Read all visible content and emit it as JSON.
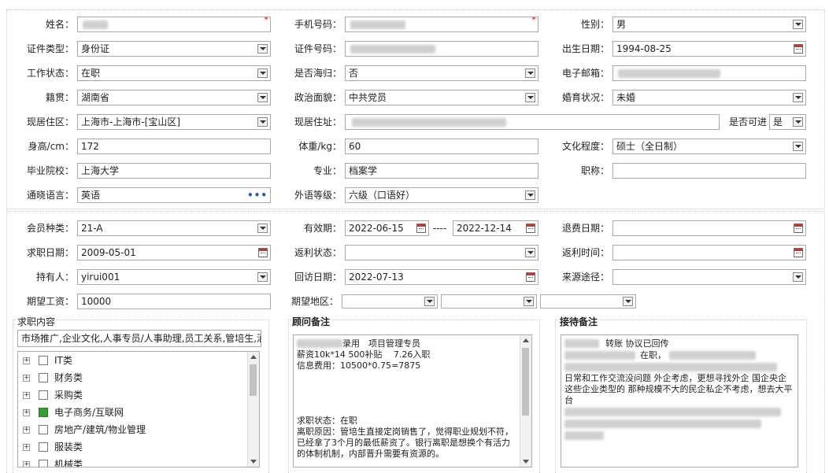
{
  "row1": {
    "name_label": "姓名：",
    "name_value": "",
    "phone_label": "手机号码：",
    "phone_value": "",
    "gender_label": "性别：",
    "gender_value": "男"
  },
  "row2": {
    "idtype_label": "证件类型：",
    "idtype_value": "身份证",
    "idno_label": "证件号码：",
    "idno_value": "",
    "birth_label": "出生日期：",
    "birth_value": "1994-08-25"
  },
  "row3": {
    "workstatus_label": "工作状态：",
    "workstatus_value": "在职",
    "returnee_label": "是否海归：",
    "returnee_value": "否",
    "email_label": "电子邮箱：",
    "email_value": ""
  },
  "row4": {
    "origin_label": "籍贯：",
    "origin_value": "湖南省",
    "politics_label": "政治面貌：",
    "politics_value": "中共党员",
    "marital_label": "婚育状况：",
    "marital_value": "未婚"
  },
  "row5": {
    "region_label": "现居住区：",
    "region_value": "上海市-上海市-[宝山区]",
    "address_label": "现居住址：",
    "address_value": "",
    "visit_label": "是否可进",
    "visit_value": "是"
  },
  "row6": {
    "height_label": "身高/cm：",
    "height_value": "172",
    "weight_label": "体重/kg：",
    "weight_value": "60",
    "edu_label": "文化程度：",
    "edu_value": "硕士（全日制）"
  },
  "row7": {
    "school_label": "毕业院校：",
    "school_value": "上海大学",
    "major_label": "专业：",
    "major_value": "档案学",
    "title_label": "职称：",
    "title_value": ""
  },
  "row8": {
    "lang_label": "通晓语言：",
    "lang_value": "英语",
    "lang_more": "•••",
    "langlevel_label": "外语等级：",
    "langlevel_value": "六级（口语好）"
  },
  "row9": {
    "member_label": "会员种类：",
    "member_value": "21-A",
    "valid_label": "有效期：",
    "valid_from": "2022-06-15",
    "valid_sep": "----",
    "valid_to": "2022-12-14",
    "refund_label": "退费日期：",
    "refund_value": ""
  },
  "row10": {
    "jobdate_label": "求职日期：",
    "jobdate_value": "2009-05-01",
    "rebate_label": "返利状态：",
    "rebate_value": "",
    "rebatetime_label": "返利时间：",
    "rebatetime_value": ""
  },
  "row11": {
    "holder_label": "持有人：",
    "holder_value": "yirui001",
    "revisit_label": "回访日期：",
    "revisit_value": "2022-07-13",
    "source_label": "来源途径：",
    "source_value": ""
  },
  "row12": {
    "salary_label": "期望工资：",
    "salary_value": "10000",
    "area_label": "期望地区：",
    "area1": "",
    "area2": "",
    "area3": ""
  },
  "job": {
    "title": "求职内容",
    "selected": "市场推广,企业文化,人事专员/人事助理,员工关系,管培生,酒",
    "tree": [
      {
        "label": "IT类",
        "checked": false
      },
      {
        "label": "财务类",
        "checked": false
      },
      {
        "label": "采购类",
        "checked": false
      },
      {
        "label": "电子商务/互联网",
        "checked": true
      },
      {
        "label": "房地产/建筑/物业管理",
        "checked": false
      },
      {
        "label": "服装类",
        "checked": false
      },
      {
        "label": "机械类",
        "checked": false
      }
    ],
    "expand_symbol": "+"
  },
  "consultant": {
    "title": "顾问备注",
    "line1": "录用　项目管理专员",
    "line2": "薪资10k*14 500补贴　 7.26入职",
    "line3": "信息费用：10500*0.75=7875",
    "line4": "求职状态：在职",
    "line5": "离职原因：管培生直接定岗销售了，觉得职业规划不符，已经拿了3个月的最低薪资了。银行离职是想换个有活力的体制机制，内部晋升需要有资源的。"
  },
  "reception": {
    "title": "接待备注",
    "line1": "转账 协议已回传",
    "line2": "在职，",
    "line3": "日常和工作交流没问题 外企考虑，更想寻找外企 国企央企这些企业类型的 那种规模不大的民企私企不考虑，想去大平台"
  },
  "colors": {
    "border": "#a9a9a9",
    "required": "#ee0000",
    "dots": "#2b57a8",
    "checked": "#3a9a3a"
  },
  "icons": {
    "dropdown": "chevron-down-icon",
    "calendar": "calendar-icon",
    "tree_expand": "plus-icon"
  }
}
